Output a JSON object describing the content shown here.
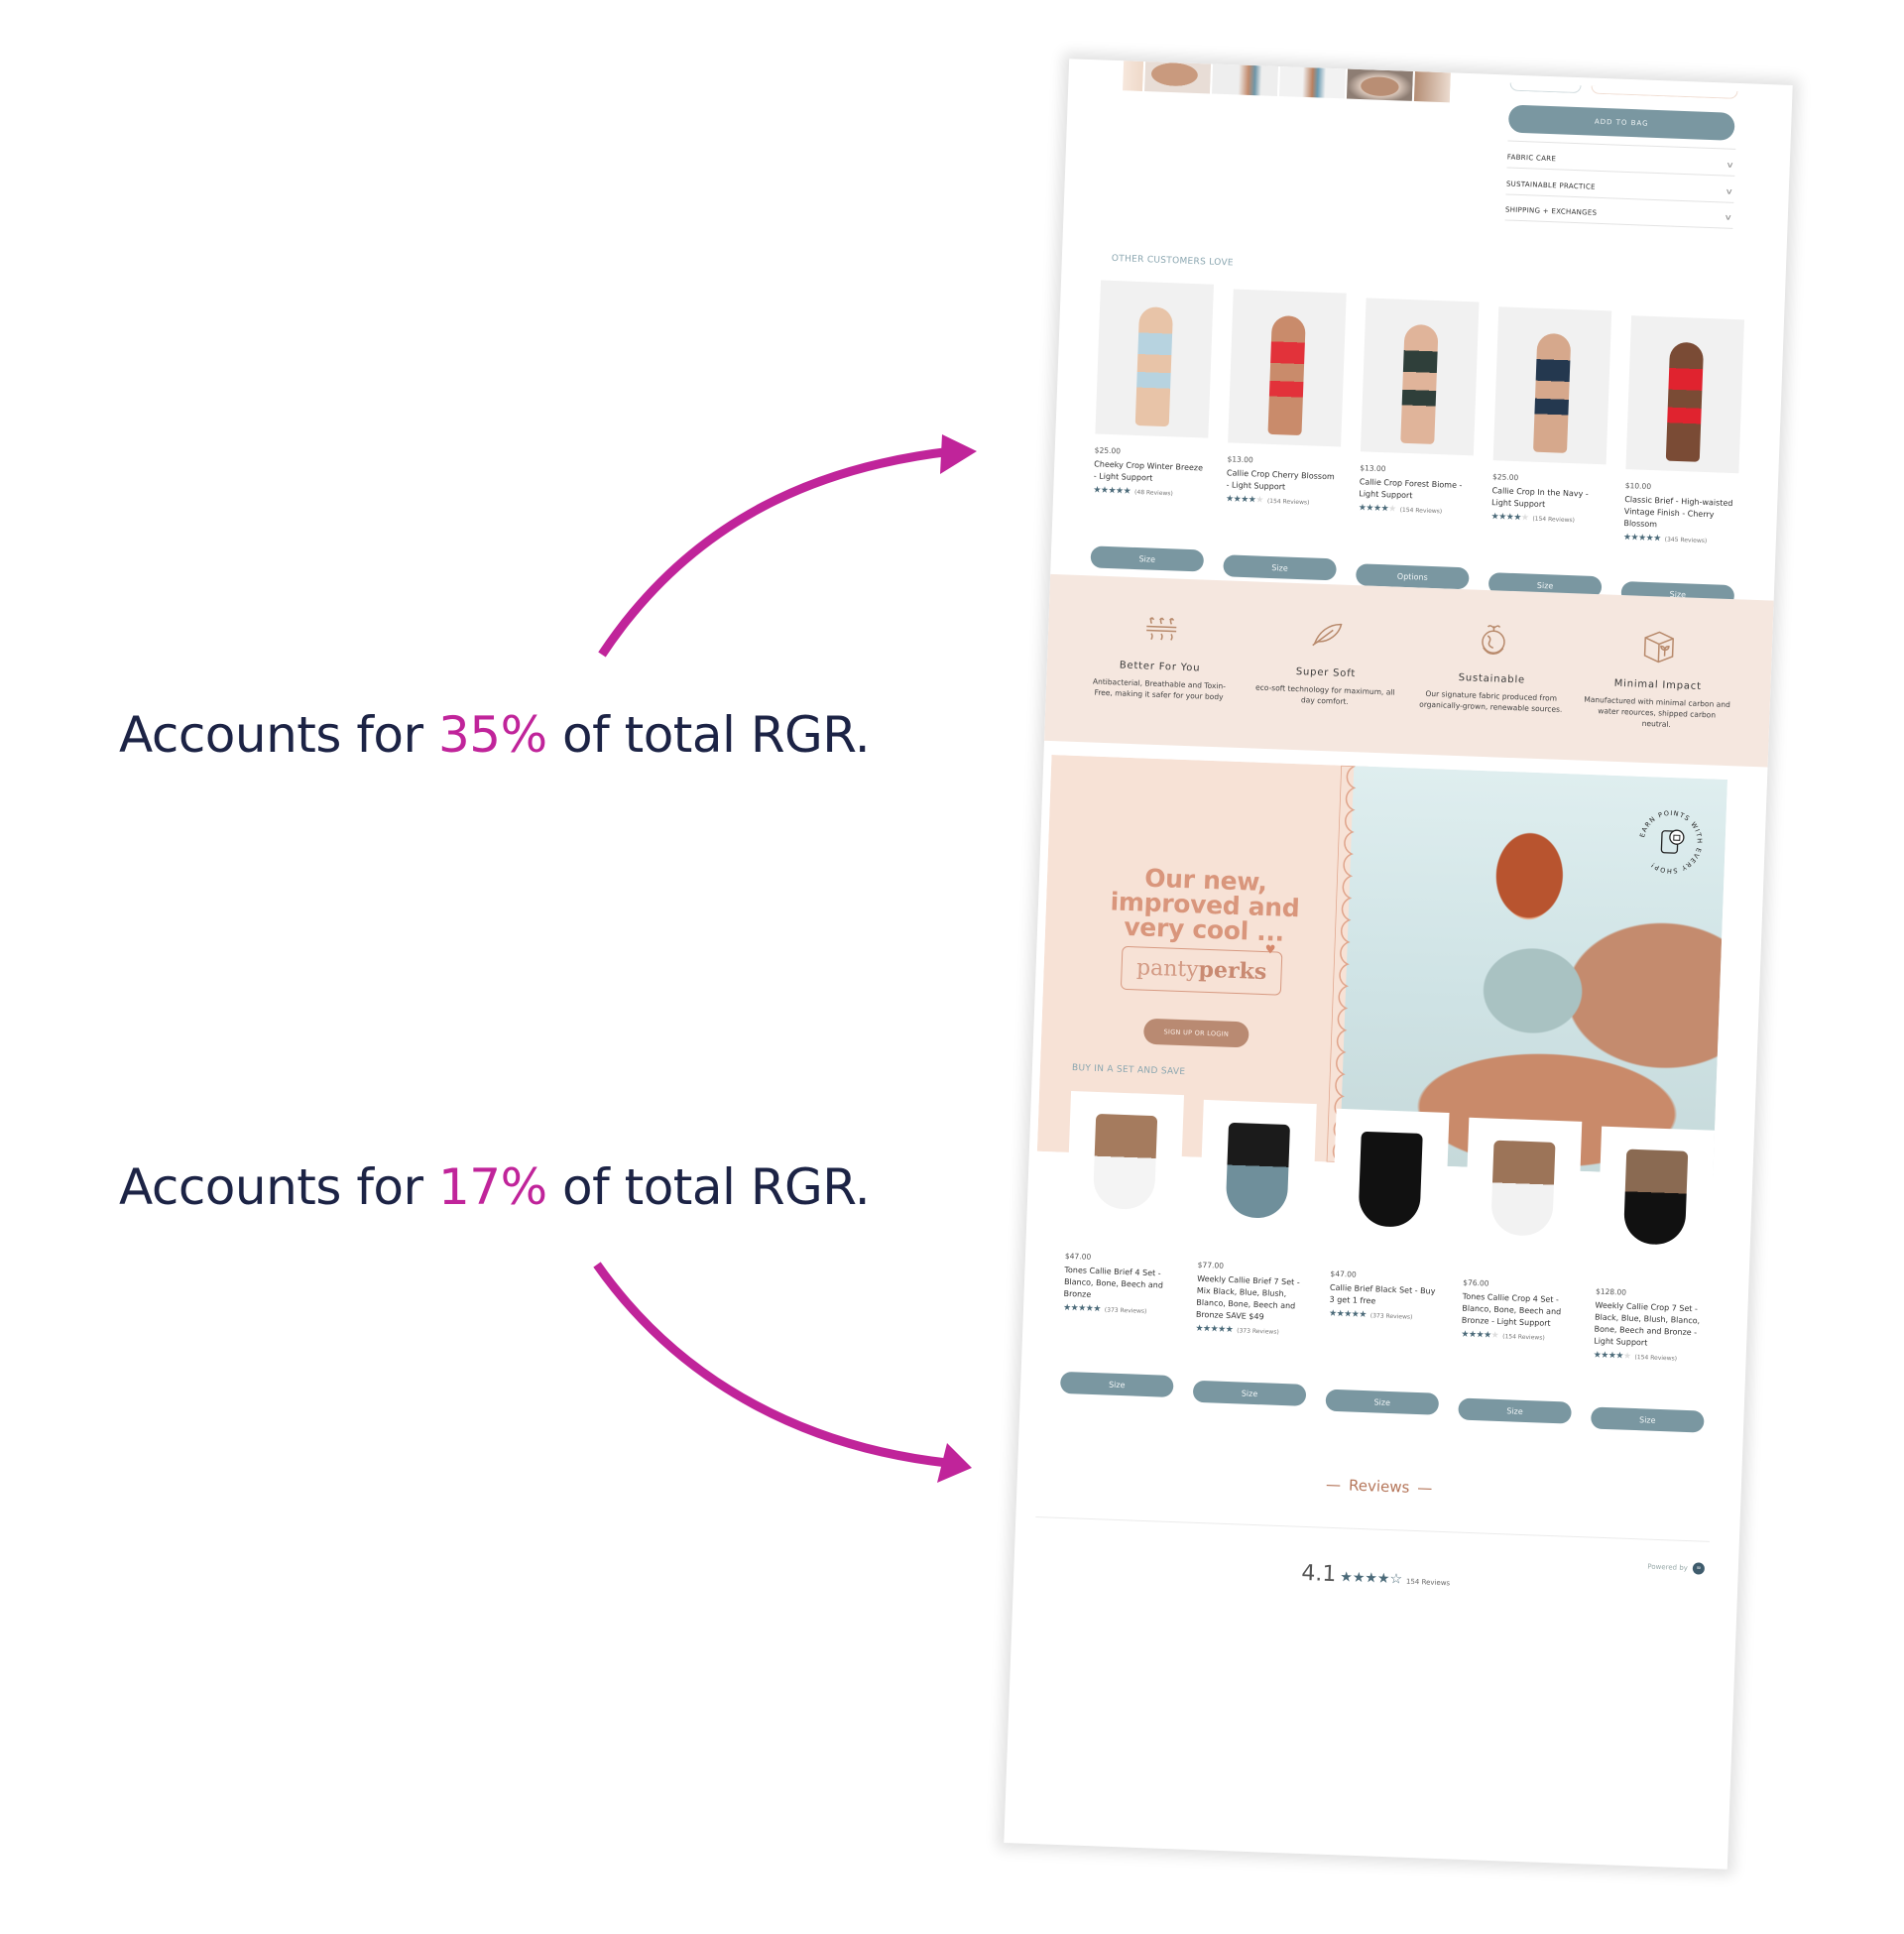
{
  "annotations": [
    {
      "prefix": "Accounts for ",
      "highlight": "35%",
      "suffix": " of total RGR."
    },
    {
      "prefix": "Accounts for ",
      "highlight": "17%",
      "suffix": " of total RGR."
    }
  ],
  "colors": {
    "annotation_text": "#1c2345",
    "highlight": "#c0249a",
    "arrow": "#c0249a",
    "button": "#7a97a1",
    "star": "#4b6a79",
    "feature_band": "#f5e7df",
    "perks_bg": "#f7e2d6",
    "perks_text": "#d9967c"
  },
  "buybox": {
    "add_to_bag": "ADD TO BAG",
    "accordion": [
      {
        "label": "FABRIC CARE",
        "icon": "chevron-down-icon"
      },
      {
        "label": "SUSTAINABLE PRACTICE",
        "icon": "chevron-down-icon"
      },
      {
        "label": "SHIPPING + EXCHANGES",
        "icon": "chevron-down-icon"
      }
    ]
  },
  "other_customers": {
    "title": "OTHER CUSTOMERS LOVE",
    "products": [
      {
        "price": "$25.00",
        "name": "Cheeky Crop Winter Breeze - Light Support",
        "rating": 5,
        "reviews": "(48 Reviews)",
        "button": "Size"
      },
      {
        "price": "$13.00",
        "name": "Callie Crop Cherry Blossom - Light Support",
        "rating": 4,
        "reviews": "(154 Reviews)",
        "button": "Size"
      },
      {
        "price": "$13.00",
        "name": "Callie Crop Forest Biome - Light Support",
        "rating": 4,
        "reviews": "(154 Reviews)",
        "button": "Options"
      },
      {
        "price": "$25.00",
        "name": "Callie Crop In the Navy - Light Support",
        "rating": 4,
        "reviews": "(154 Reviews)",
        "button": "Size"
      },
      {
        "price": "$10.00",
        "name": "Classic Brief - High-waisted Vintage Finish - Cherry Blossom",
        "rating": 5,
        "reviews": "(345 Reviews)",
        "button": "Size"
      }
    ]
  },
  "features": [
    {
      "icon": "breathable-icon",
      "title": "Better For You",
      "desc": "Antibacterial, Breathable and Toxin-Free, making it safer for your body"
    },
    {
      "icon": "feather-icon",
      "title": "Super Soft",
      "desc": "eco-soft technology for maximum, all day comfort."
    },
    {
      "icon": "earth-hands-icon",
      "title": "Sustainable",
      "desc": "Our signature fabric produced from organically-grown, renewable sources."
    },
    {
      "icon": "box-sprout-icon",
      "title": "Minimal Impact",
      "desc": "Manufactured with minimal carbon and water reources, shipped carbon neutral."
    }
  ],
  "perks": {
    "headline": "Our new, improved and very cool ...",
    "logo_light": "panty",
    "logo_bold": "perks",
    "cta": "SIGN UP OR LOGIN",
    "badge_text": "EARN POINTS WITH EVERY SHOP!"
  },
  "sets": {
    "title": "BUY IN A SET AND SAVE",
    "products": [
      {
        "price": "$47.00",
        "name": "Tones Callie Brief 4 Set - Blanco, Bone, Beech and Bronze",
        "rating": 5,
        "reviews": "(373 Reviews)",
        "button": "Size"
      },
      {
        "price": "$77.00",
        "name": "Weekly Callie Brief 7 Set - Mix Black, Blue, Blush, Blanco, Bone, Beech and Bronze SAVE $49",
        "rating": 5,
        "reviews": "(373 Reviews)",
        "button": "Size"
      },
      {
        "price": "$47.00",
        "name": "Callie Brief Black Set - Buy 3 get 1 free",
        "rating": 5,
        "reviews": "(373 Reviews)",
        "button": "Size"
      },
      {
        "price": "$76.00",
        "name": "Tones Callie Crop 4 Set - Blanco, Bone, Beech and Bronze - Light Support",
        "rating": 4,
        "reviews": "(154 Reviews)",
        "button": "Size"
      },
      {
        "price": "$128.00",
        "name": "Weekly Callie Crop 7 Set - Black, Blue, Blush, Blanco, Bone, Beech and Bronze - Light Support",
        "rating": 4,
        "reviews": "(154 Reviews)",
        "button": "Size"
      }
    ]
  },
  "reviews": {
    "heading": "Reviews",
    "powered_by": "Powered by",
    "score": "4.1",
    "stars": 4,
    "count": "154 Reviews"
  }
}
